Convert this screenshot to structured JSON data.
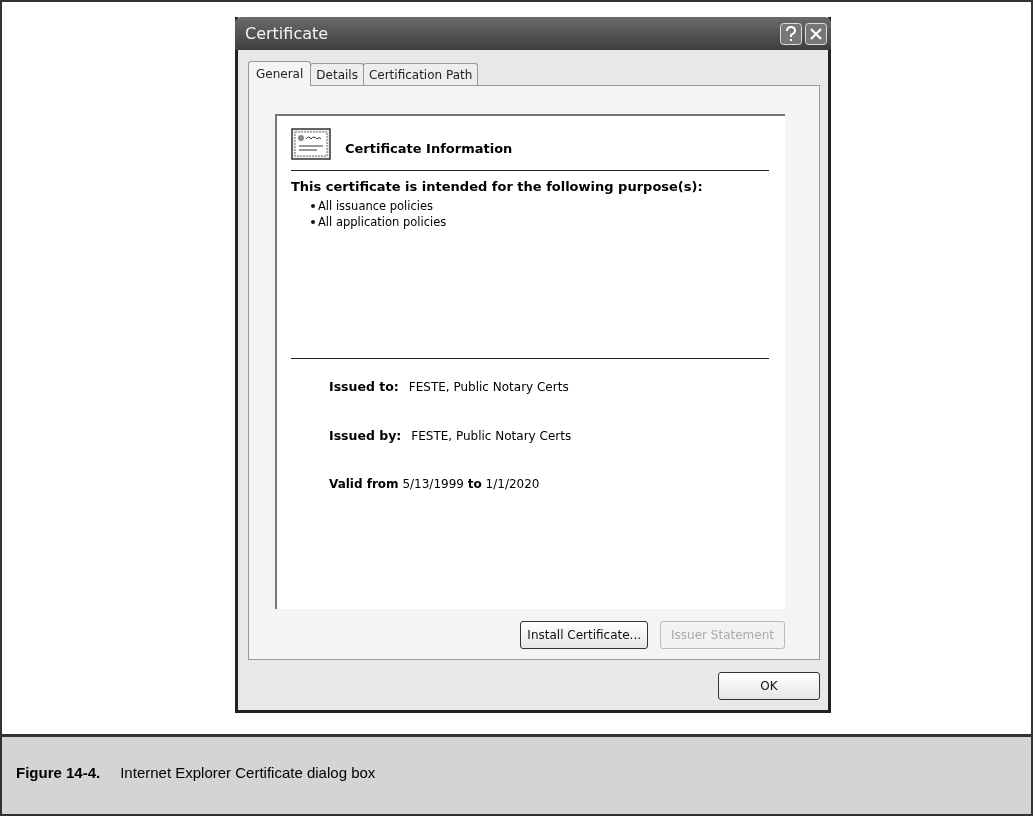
{
  "window": {
    "title": "Certificate"
  },
  "tabs": [
    {
      "label": "General",
      "selected": true
    },
    {
      "label": "Details",
      "selected": false
    },
    {
      "label": "Certification Path",
      "selected": false
    }
  ],
  "info": {
    "heading": "Certificate Information",
    "purpose_heading": "This certificate is intended for the following purpose(s):",
    "purposes": [
      "All issuance policies",
      "All application policies"
    ],
    "fields": [
      {
        "label": "Issued to:",
        "value": "FESTE, Public Notary Certs"
      },
      {
        "label": "Issued by:",
        "value": "FESTE, Public Notary Certs"
      }
    ],
    "validity": "**Valid from** 5/13/1999 **to** 1/1/2020"
  },
  "buttons": [
    {
      "label": "Install Certificate...",
      "disabled": false
    },
    {
      "label": "Issuer Statement",
      "disabled": true
    }
  ],
  "ok_button": "OK",
  "caption": {
    "number": "Figure 14-4.",
    "text": "Internet Explorer Certificate dialog box"
  }
}
